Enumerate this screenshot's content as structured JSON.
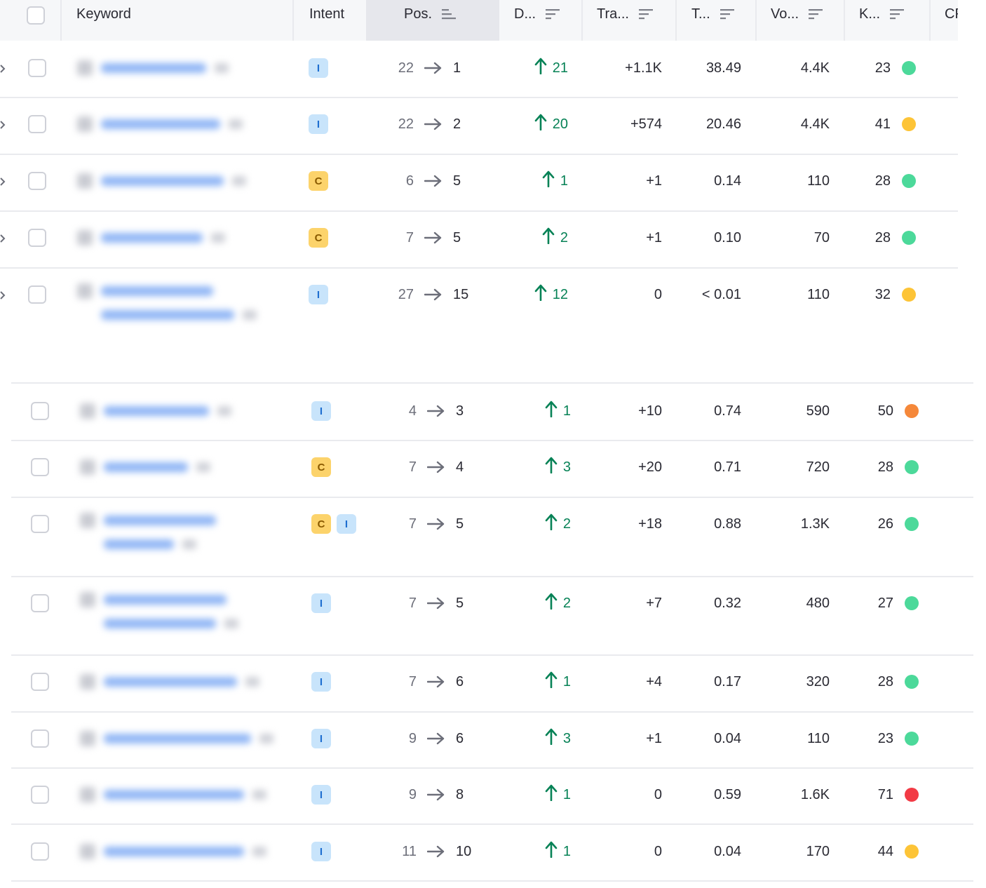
{
  "columns": {
    "keyword": "Keyword",
    "intent": "Intent",
    "position": "Pos.",
    "difference": "D...",
    "traffic": "Tra...",
    "traffic_pct": "T...",
    "volume": "Vo...",
    "kd": "K...",
    "cpc": "CP"
  },
  "colors": {
    "accent_green": "#078256",
    "kd_easy": "#4cd99a",
    "kd_possible": "#fdc437",
    "kd_difficult": "#f5883a",
    "kd_hard": "#f23a45",
    "intent_informational": "#c8e4fb",
    "intent_commercial": "#fcd36b"
  },
  "rows_top": [
    {
      "intent": [
        "I"
      ],
      "from": "22",
      "to": "1",
      "diff": "21",
      "traffic": "+1.1K",
      "tpct": "38.49",
      "volume": "4.4K",
      "kd": "23",
      "kd_color": "#4cd99a"
    },
    {
      "intent": [
        "I"
      ],
      "from": "22",
      "to": "2",
      "diff": "20",
      "traffic": "+574",
      "tpct": "20.46",
      "volume": "4.4K",
      "kd": "41",
      "kd_color": "#fdc437"
    },
    {
      "intent": [
        "C"
      ],
      "from": "6",
      "to": "5",
      "diff": "1",
      "traffic": "+1",
      "tpct": "0.14",
      "volume": "110",
      "kd": "28",
      "kd_color": "#4cd99a"
    },
    {
      "intent": [
        "C"
      ],
      "from": "7",
      "to": "5",
      "diff": "2",
      "traffic": "+1",
      "tpct": "0.10",
      "volume": "70",
      "kd": "28",
      "kd_color": "#4cd99a"
    },
    {
      "intent": [
        "I"
      ],
      "from": "27",
      "to": "15",
      "diff": "12",
      "traffic": "0",
      "tpct": "< 0.01",
      "volume": "110",
      "kd": "32",
      "kd_color": "#fdc437"
    }
  ],
  "rows_bottom": [
    {
      "intent": [
        "I"
      ],
      "from": "4",
      "to": "3",
      "diff": "1",
      "traffic": "+10",
      "tpct": "0.74",
      "volume": "590",
      "kd": "50",
      "kd_color": "#f5883a"
    },
    {
      "intent": [
        "C"
      ],
      "from": "7",
      "to": "4",
      "diff": "3",
      "traffic": "+20",
      "tpct": "0.71",
      "volume": "720",
      "kd": "28",
      "kd_color": "#4cd99a"
    },
    {
      "intent": [
        "C",
        "I"
      ],
      "from": "7",
      "to": "5",
      "diff": "2",
      "traffic": "+18",
      "tpct": "0.88",
      "volume": "1.3K",
      "kd": "26",
      "kd_color": "#4cd99a"
    },
    {
      "intent": [
        "I"
      ],
      "from": "7",
      "to": "5",
      "diff": "2",
      "traffic": "+7",
      "tpct": "0.32",
      "volume": "480",
      "kd": "27",
      "kd_color": "#4cd99a"
    },
    {
      "intent": [
        "I"
      ],
      "from": "7",
      "to": "6",
      "diff": "1",
      "traffic": "+4",
      "tpct": "0.17",
      "volume": "320",
      "kd": "28",
      "kd_color": "#4cd99a"
    },
    {
      "intent": [
        "I"
      ],
      "from": "9",
      "to": "6",
      "diff": "3",
      "traffic": "+1",
      "tpct": "0.04",
      "volume": "110",
      "kd": "23",
      "kd_color": "#4cd99a"
    },
    {
      "intent": [
        "I"
      ],
      "from": "9",
      "to": "8",
      "diff": "1",
      "traffic": "0",
      "tpct": "0.59",
      "volume": "1.6K",
      "kd": "71",
      "kd_color": "#f23a45"
    },
    {
      "intent": [
        "I"
      ],
      "from": "11",
      "to": "10",
      "diff": "1",
      "traffic": "0",
      "tpct": "0.04",
      "volume": "170",
      "kd": "44",
      "kd_color": "#fdc437"
    }
  ]
}
